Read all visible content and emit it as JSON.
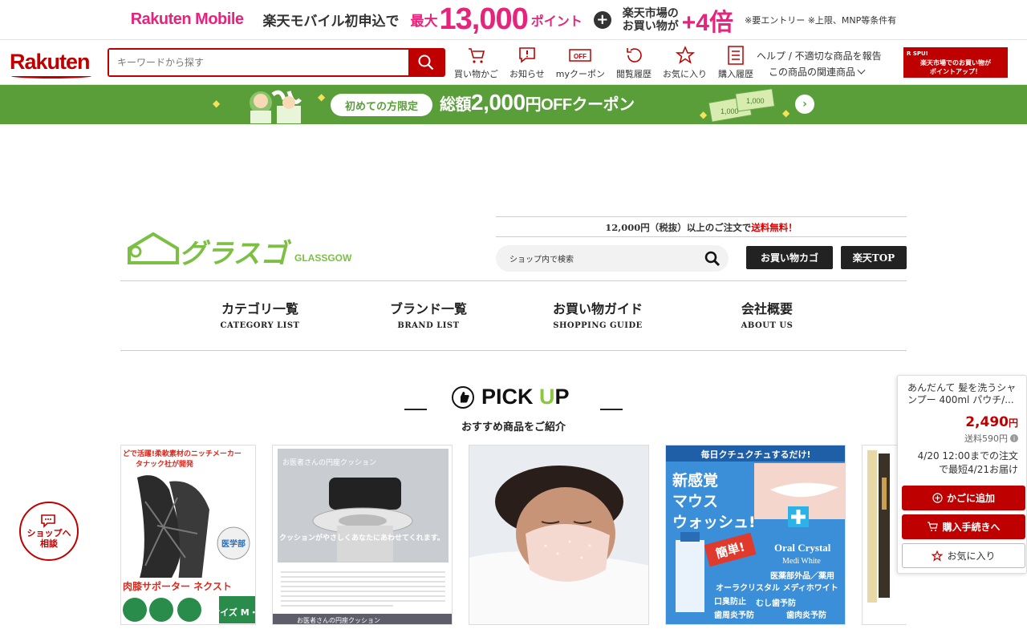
{
  "promo": {
    "brand": "Rakuten Mobile",
    "text": "楽天モバイル初申込で",
    "max": "最大",
    "points": "13,000",
    "points_unit": "ポイント",
    "plus": "+",
    "market_line1": "楽天市場の",
    "market_line2": "お買い物が",
    "times": "+4倍",
    "note": "※要エントリー ※上限、MNP等条件有"
  },
  "header": {
    "logo": "Rakuten",
    "search_placeholder": "キーワードから探す",
    "nav": [
      {
        "label": "買い物かご",
        "icon": "cart-icon"
      },
      {
        "label": "お知らせ",
        "icon": "notification-icon"
      },
      {
        "label": "myクーポン",
        "icon": "coupon-icon"
      },
      {
        "label": "閲覧履歴",
        "icon": "history-icon"
      },
      {
        "label": "お気に入り",
        "icon": "star-icon"
      },
      {
        "label": "購入履歴",
        "icon": "purchase-history-icon"
      }
    ],
    "help": "ヘルプ / 不適切な商品を報告",
    "related": "この商品の関連商品",
    "spu_title": "R SPU!",
    "spu_line1": "楽天市場でのお買い物が",
    "spu_line2": "ポイントアップ！"
  },
  "coupon": {
    "pill": "初めての方限定",
    "text_prefix": "総額",
    "amount": "2,000",
    "text_suffix": "円OFFクーポン",
    "bill1": "1,000",
    "bill2": "1,000"
  },
  "shop": {
    "logo_text": "グラスゴ",
    "logo_sub": "GLASSGOW",
    "shipping_prefix": "12,000円（税抜）以上のご注文で",
    "shipping_free": "送料無料！",
    "search_placeholder": "ショップ内で検索",
    "cart_btn": "お買い物カゴ",
    "top_btn": "楽天TOP",
    "nav": [
      {
        "jp": "カテゴリ一覧",
        "en": "CATEGORY LIST"
      },
      {
        "jp": "ブランド一覧",
        "en": "BRAND LIST"
      },
      {
        "jp": "お買い物ガイド",
        "en": "SHOPPING GUIDE"
      },
      {
        "jp": "会社概要",
        "en": "ABOUT US"
      }
    ]
  },
  "pickup": {
    "title_a": "PICK ",
    "title_u": "U",
    "title_b": "P",
    "subtitle": "おすすめ商品をご紹介"
  },
  "products": [
    {
      "name": "knee-support",
      "top": "どで活躍!柔軟素材のニッチメーカー",
      "top2": "タナック社が開発",
      "bottom": "肉膝サポーター ネクスト",
      "size": "サイズ M・L"
    },
    {
      "name": "seat-cushion",
      "title": "お医者さんの円座クッション",
      "caption": "クッションがやさしくあなたにあわせてくれます。",
      "bottom": "お医者さんの円座クッション"
    },
    {
      "name": "sleep-mask",
      "label": ""
    },
    {
      "name": "mouthwash",
      "top": "毎日クチュクチュするだけ!",
      "headline1": "新感覚",
      "headline2": "マウス",
      "headline3": "ウォッシュ!",
      "easy": "簡単!",
      "brand": "Oral Crystal",
      "brand_sub": "Medi White",
      "category": "医薬部外品／薬用",
      "product_jp": "オーラクリスタル メディホワイト",
      "benefit1": "口臭防止",
      "benefit2": "むし歯予防",
      "benefit3": "歯周炎予防",
      "benefit4": "歯肉炎予防"
    },
    {
      "name": "partial-product",
      "label": ""
    }
  ],
  "chat": {
    "line1": "ショップへ",
    "line2": "相談"
  },
  "float_panel": {
    "title": "あんだんて 髪を洗うシャンプー 400ml パウチ/...",
    "price": "2,490",
    "price_unit": "円",
    "shipping": "送料590円",
    "delivery_line1": "4/20 12:00までの注文",
    "delivery_line2": "で最短4/21お届け",
    "add_cart": "かごに追加",
    "checkout": "購入手続きへ",
    "favorite": "お気に入り"
  },
  "colors": {
    "rakuten_red": "#bf0000",
    "mobile_pink": "#e5247c",
    "coupon_green": "#5a9e3a",
    "pickup_green": "#8cc63f"
  }
}
